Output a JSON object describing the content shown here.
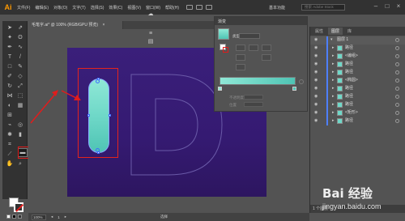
{
  "app": {
    "logo": "Ai",
    "menus": [
      "文件(F)",
      "编辑(E)",
      "对象(O)",
      "文字(T)",
      "选择(S)",
      "效果(C)",
      "视图(V)",
      "窗口(W)",
      "帮助(H)"
    ],
    "workspace": "基本功能",
    "search_placeholder": "搜索 Adobe Stock",
    "window_controls": [
      "minimize-icon",
      "maximize-icon",
      "close-icon"
    ]
  },
  "document": {
    "tab_title": "毛笔字.ai* @ 100% (RGB/GPU 预览)",
    "close_symbol": "×"
  },
  "toolbar": {
    "tools": [
      "selection-tool",
      "direct-selection-tool",
      "magic-wand-tool",
      "lasso-tool",
      "pen-tool",
      "curvature-tool",
      "type-tool",
      "line-tool",
      "rectangle-tool",
      "paintbrush-tool",
      "shaper-tool",
      "eraser-tool",
      "rotate-tool",
      "scale-tool",
      "width-tool",
      "free-transform-tool",
      "shape-builder-tool",
      "perspective-grid-tool",
      "mesh-tool",
      "gradient-tool",
      "eyedropper-tool",
      "blend-tool",
      "symbol-sprayer-tool",
      "column-graph-tool",
      "artboard-tool",
      "slice-tool",
      "hand-tool",
      "zoom-tool"
    ],
    "selected_tool": "gradient-tool",
    "highlight_color": "#e11c1c"
  },
  "canvas": {
    "artboard_gradient": [
      "#3a1f7a",
      "#2d1660"
    ],
    "shape_gradient": [
      "#8fe8d6",
      "#4fc4b4"
    ],
    "letter": "D"
  },
  "gradient_panel": {
    "title": "渐变",
    "type_label": "类型:",
    "type_value": "",
    "fields": [
      {
        "label": "",
        "value": ""
      },
      {
        "label": "不透明度",
        "value": ""
      },
      {
        "label": "位置",
        "value": ""
      }
    ]
  },
  "layers_panel": {
    "tabs": [
      "属性",
      "图层",
      "库"
    ],
    "active_tab": "图层",
    "rows": [
      {
        "name": "图层 1",
        "indent": 0,
        "expanded": true
      },
      {
        "name": "路径",
        "indent": 1
      },
      {
        "name": "<编组>",
        "indent": 1
      },
      {
        "name": "路径",
        "indent": 1
      },
      {
        "name": "路径",
        "indent": 1
      },
      {
        "name": "<椭圆>",
        "indent": 1
      },
      {
        "name": "路径",
        "indent": 1
      },
      {
        "name": "路径",
        "indent": 1
      },
      {
        "name": "路径",
        "indent": 1
      },
      {
        "name": "<矩形>",
        "indent": 1
      },
      {
        "name": "路径",
        "indent": 1
      }
    ],
    "footer": "1 个图层"
  },
  "status_bar": {
    "zoom": "100%",
    "page": "1",
    "mode": "选择"
  },
  "watermark": {
    "title": "Bai 经验",
    "url": "jingyan.baidu.com"
  }
}
